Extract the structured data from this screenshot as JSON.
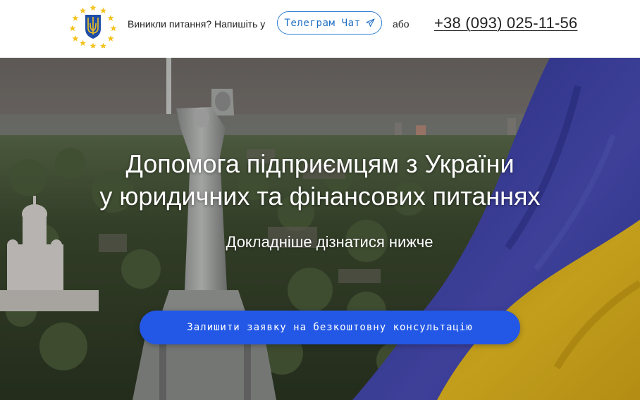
{
  "header": {
    "question_text": "Виникли питання? Напишіть у",
    "telegram_button_label": "Телеграм Чат",
    "or_text": "або",
    "phone": "+38 (093) 025-11-56"
  },
  "hero": {
    "title_line1": "Допомога підприємцям з України",
    "title_line2": "у юридичних та фінансових питаннях",
    "subtitle": "Докладніше дізнатися нижче",
    "cta_label": "Залишити заявку на безкоштовну консультацію"
  },
  "icons": {
    "logo": "ukraine-trident-eu-stars-logo",
    "telegram": "paper-plane-icon"
  },
  "colors": {
    "accent_blue": "#2358e6",
    "telegram_blue": "#2e7fd2",
    "flag_blue": "#3b3fa6",
    "flag_yellow": "#e3b81e"
  }
}
